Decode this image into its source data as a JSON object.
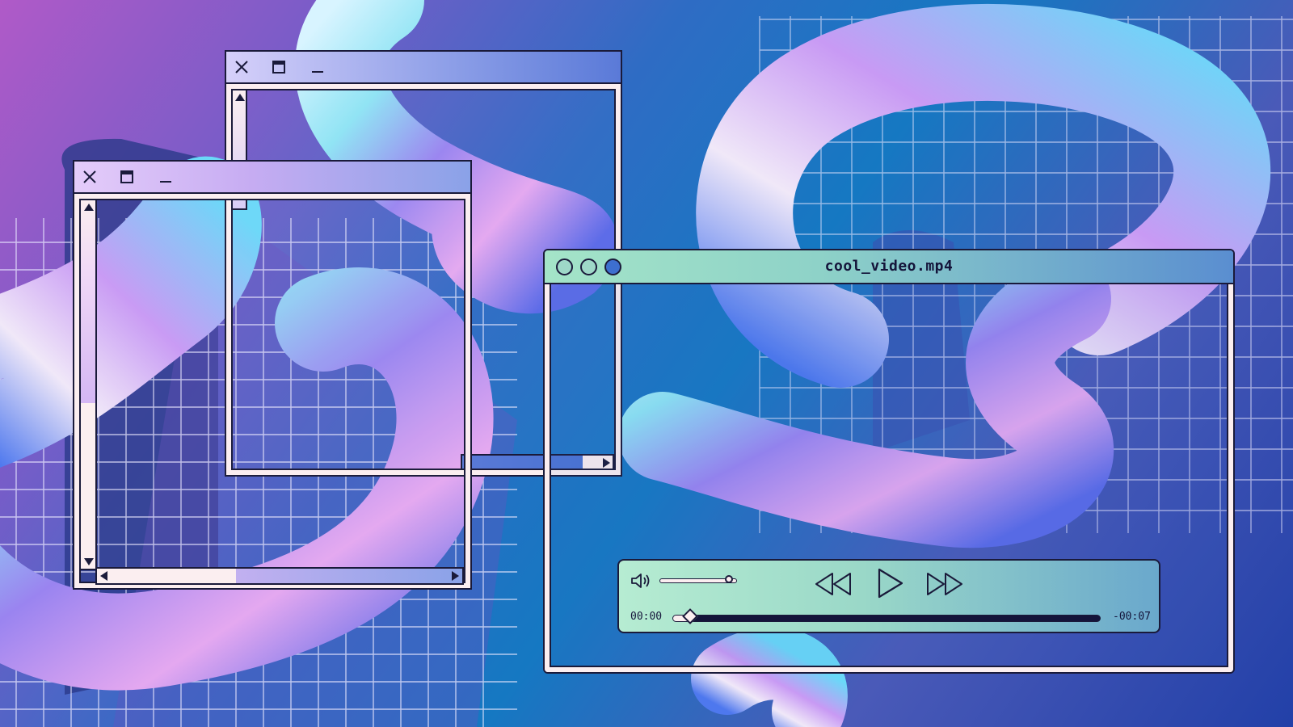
{
  "background": {
    "gradient_colors": [
      "#b05ac8",
      "#2f6cc4",
      "#1578c2",
      "#2240a8"
    ],
    "grid_color": "#e8e6ff",
    "blob_color": "#8fd8f2"
  },
  "window_back": {
    "close_icon": "close-icon",
    "maximize_icon": "maximize-icon",
    "minimize_icon": "minimize-icon",
    "titlebar_color": "#7f8fe0"
  },
  "window_front": {
    "close_icon": "close-icon",
    "maximize_icon": "maximize-icon",
    "minimize_icon": "minimize-icon",
    "titlebar_color": "#c8a8f0"
  },
  "player": {
    "title": "cool_video.mp4",
    "traffic_lights": [
      "#9ed8c8",
      "#9ed8c8",
      "#3d6fcf"
    ],
    "volume_icon": "speaker-icon",
    "volume_level": 0.9,
    "rewind_icon": "rewind-icon",
    "play_icon": "play-icon",
    "fast_forward_icon": "fast-forward-icon",
    "time_elapsed": "00:00",
    "time_remaining": "-00:07",
    "progress": 0.04
  }
}
